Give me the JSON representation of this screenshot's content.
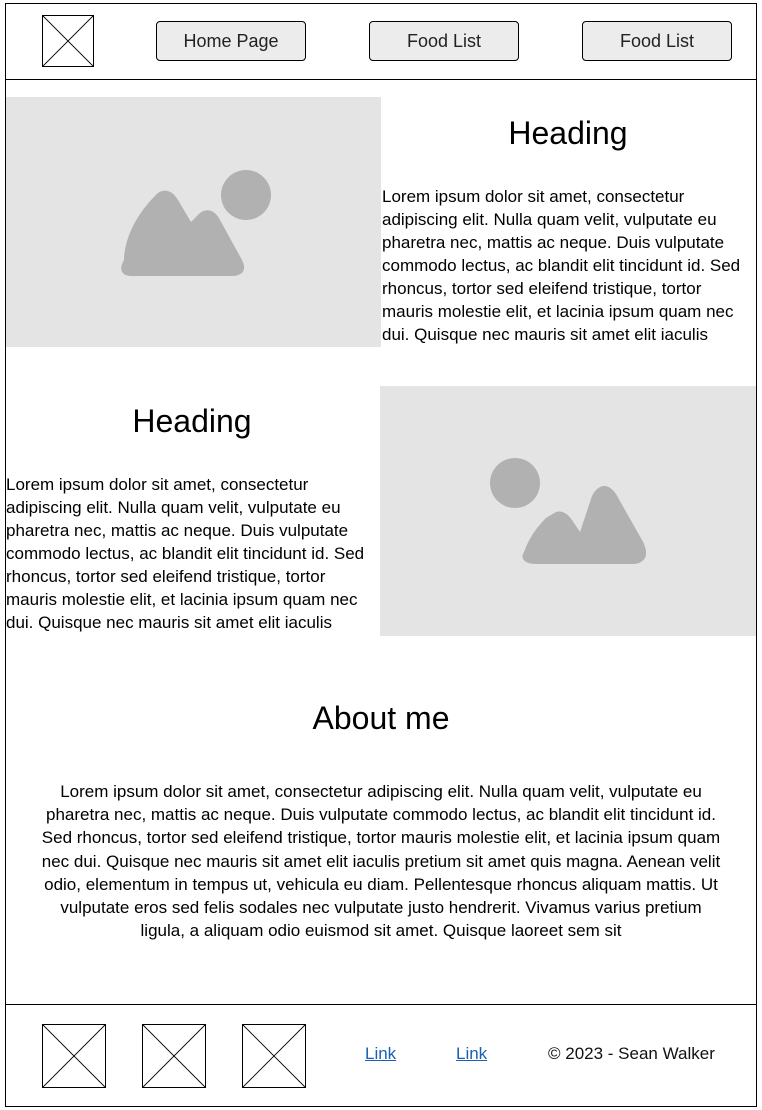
{
  "header": {
    "logo_icon": "placeholder-image-icon",
    "nav": [
      {
        "label": "Home Page"
      },
      {
        "label": "Food List"
      },
      {
        "label": "Food List"
      }
    ]
  },
  "sections": [
    {
      "heading": "Heading",
      "image_icon": "image-placeholder-icon",
      "text": "Lorem ipsum dolor sit amet, consectetur adipiscing elit. Nulla quam velit, vulputate eu pharetra nec, mattis ac neque. Duis vulputate commodo lectus, ac blandit elit tincidunt id. Sed rhoncus, tortor sed eleifend tristique, tortor mauris molestie elit, et lacinia ipsum quam nec dui. Quisque nec mauris sit amet elit iaculis"
    },
    {
      "heading": "Heading",
      "image_icon": "image-placeholder-icon",
      "text": "Lorem ipsum dolor sit amet, consectetur adipiscing elit. Nulla quam velit, vulputate eu pharetra nec, mattis ac neque. Duis vulputate commodo lectus, ac blandit elit tincidunt id. Sed rhoncus, tortor sed eleifend tristique, tortor mauris molestie elit, et lacinia ipsum quam nec dui. Quisque nec mauris sit amet elit iaculis"
    }
  ],
  "about": {
    "title": "About me",
    "text": "Lorem ipsum dolor sit amet, consectetur adipiscing elit. Nulla quam velit, vulputate eu pharetra nec, mattis ac neque. Duis vulputate commodo lectus, ac blandit elit tincidunt id. Sed rhoncus, tortor sed eleifend tristique, tortor mauris molestie elit, et lacinia ipsum quam nec dui. Quisque nec mauris sit amet elit iaculis pretium sit amet quis magna. Aenean velit odio, elementum in tempus ut, vehicula eu diam. Pellentesque rhoncus aliquam mattis. Ut vulputate eros sed felis sodales nec vulputate justo hendrerit. Vivamus varius pretium ligula, a aliquam odio euismod sit amet. Quisque laoreet sem sit"
  },
  "footer": {
    "social_icons": [
      "placeholder-image-icon",
      "placeholder-image-icon",
      "placeholder-image-icon"
    ],
    "links": [
      {
        "label": "Link"
      },
      {
        "label": "Link"
      }
    ],
    "copyright": "© 2023 - Sean Walker"
  },
  "colors": {
    "placeholder_bg": "#e4e4e4",
    "placeholder_shape": "#b1b1b1",
    "button_bg": "#ececec",
    "link": "#1a5fb4"
  }
}
